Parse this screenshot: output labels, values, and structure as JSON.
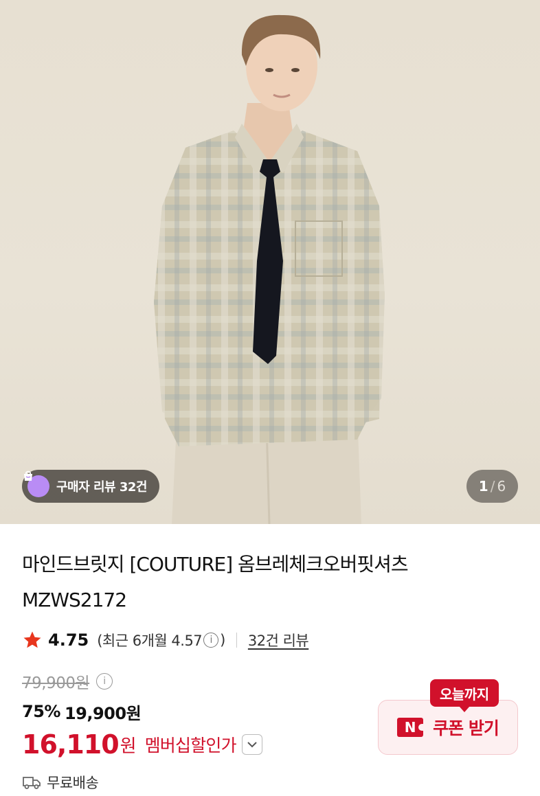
{
  "gallery": {
    "review_badge": "구매자 리뷰 32건",
    "current_index": "1",
    "separator": "/",
    "total": "6"
  },
  "product": {
    "title_line1": "마인드브릿지 [COUTURE] 옴브레체크오버핏셔츠",
    "title_line2": "MZWS2172"
  },
  "rating": {
    "score": "4.75",
    "recent_prefix": "(최근 6개월 4.57",
    "recent_suffix": ")",
    "info_glyph": "i",
    "reviews_link": "32건 리뷰"
  },
  "price": {
    "original": "79,900원",
    "discount_percent": "75%",
    "sale_price": "19,900원",
    "member_price": "16,110",
    "member_currency": "원",
    "member_label": "멤버십할인가"
  },
  "shipping": {
    "label": "무료배송"
  },
  "coupon": {
    "badge": "오늘까지",
    "logo_letter": "N",
    "button_label": "쿠폰 받기"
  },
  "colors": {
    "accent_red": "#d1112b",
    "review_badge_purple": "#b98cf5",
    "background_beige": "#e7e0d2"
  }
}
